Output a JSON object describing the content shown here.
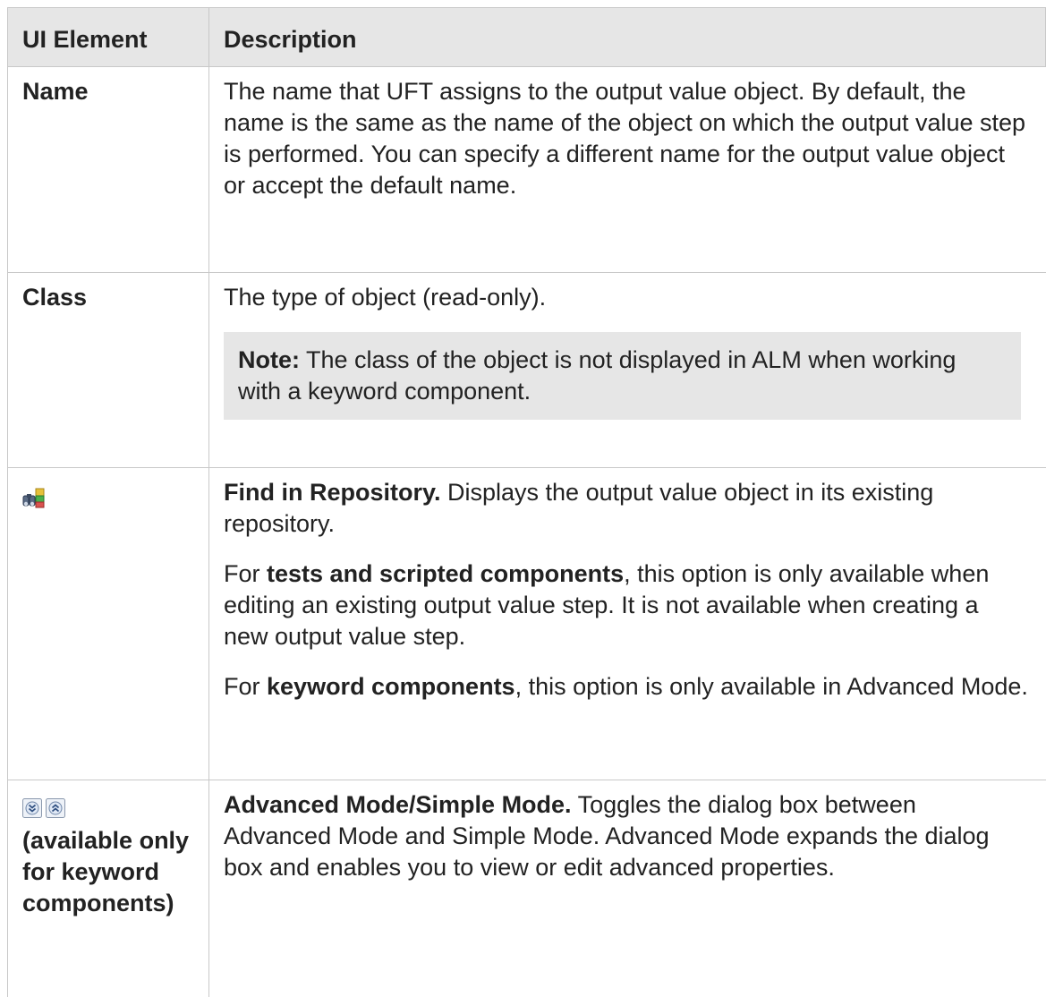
{
  "table": {
    "header": {
      "col1": "UI Element",
      "col2": "Description"
    },
    "rows": [
      {
        "term": "Name",
        "desc": "The name that UFT assigns to the output value object. By default, the name is the same as the name of the object on which the output value step is performed. You can specify a different name for the output value object or accept the default name."
      },
      {
        "term": "Class",
        "desc": "The type of object (read-only).",
        "note_label": "Note:",
        "note_text": " The class of the object is not displayed in ALM when working with a keyword component."
      },
      {
        "icon": "find-in-repository-icon",
        "bold": "Find in Repository.",
        "desc": " Displays the output value object in its existing repository.",
        "p2_pre": "For ",
        "p2_bold": "tests and scripted components",
        "p2_rest": ", this option is only available when editing an existing output value step. It is not available when creating a new output value step.",
        "p3_pre": "For ",
        "p3_bold": "keyword components",
        "p3_rest": ", this option is only available in Advanced Mode."
      },
      {
        "icons": [
          "advanced-mode-icon",
          "simple-mode-icon"
        ],
        "term_note": "(available only for keyword components)",
        "bold": "Advanced Mode/Simple Mode.",
        "desc": " Toggles the dialog box between Advanced Mode and Simple Mode. Advanced Mode expands the dialog box and enables you to view or edit advanced properties."
      }
    ]
  }
}
